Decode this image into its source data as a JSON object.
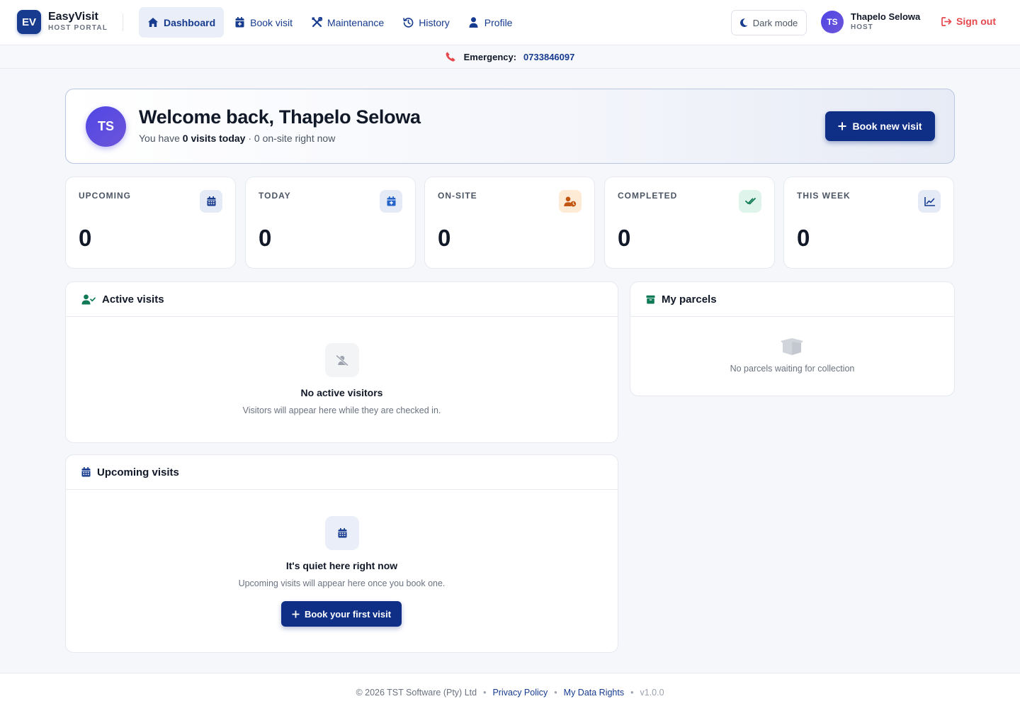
{
  "brand": {
    "logo": "EV",
    "name": "EasyVisit",
    "subtitle": "HOST PORTAL"
  },
  "nav": {
    "items": [
      {
        "label": "Dashboard",
        "icon": "home-icon",
        "active": true
      },
      {
        "label": "Book visit",
        "icon": "calendar-plus-icon"
      },
      {
        "label": "Maintenance",
        "icon": "tools-icon"
      },
      {
        "label": "History",
        "icon": "history-icon"
      },
      {
        "label": "Profile",
        "icon": "user-icon"
      }
    ],
    "dark_mode_label": "Dark mode",
    "sign_out_label": "Sign out"
  },
  "user": {
    "initials": "TS",
    "name": "Thapelo Selowa",
    "role": "HOST"
  },
  "emergency": {
    "label": "Emergency:",
    "number": "0733846097"
  },
  "welcome": {
    "initials": "TS",
    "title": "Welcome back, Thapelo Selowa",
    "sub_prefix": "You have",
    "visits_today": "0 visits today",
    "sub_suffix": "· 0 on-site right now",
    "book_button": "Book new visit"
  },
  "stats": [
    {
      "label": "UPCOMING",
      "value": "0",
      "icon": "calendar-icon"
    },
    {
      "label": "TODAY",
      "value": "0",
      "icon": "calendar-plus-icon"
    },
    {
      "label": "ON-SITE",
      "value": "0",
      "icon": "user-clock-icon"
    },
    {
      "label": "COMPLETED",
      "value": "0",
      "icon": "double-check-icon"
    },
    {
      "label": "THIS WEEK",
      "value": "0",
      "icon": "line-chart-icon"
    }
  ],
  "active_visits": {
    "title": "Active visits",
    "empty_title": "No active visitors",
    "empty_text": "Visitors will appear here while they are checked in."
  },
  "parcels": {
    "title": "My parcels",
    "empty_text": "No parcels waiting for collection"
  },
  "upcoming_visits": {
    "title": "Upcoming visits",
    "empty_title": "It's quiet here right now",
    "empty_text": "Upcoming visits will appear here once you book one.",
    "button": "Book your first visit"
  },
  "footer": {
    "copyright": "© 2026 TST Software (Pty) Ltd",
    "privacy": "Privacy Policy",
    "data_rights": "My Data Rights",
    "version": "v1.0.0"
  },
  "colors": {
    "brand": "#163b8f",
    "button": "#0f2f86",
    "danger": "#e5484d",
    "success": "#0f7a55",
    "warning": "#c2550f"
  }
}
